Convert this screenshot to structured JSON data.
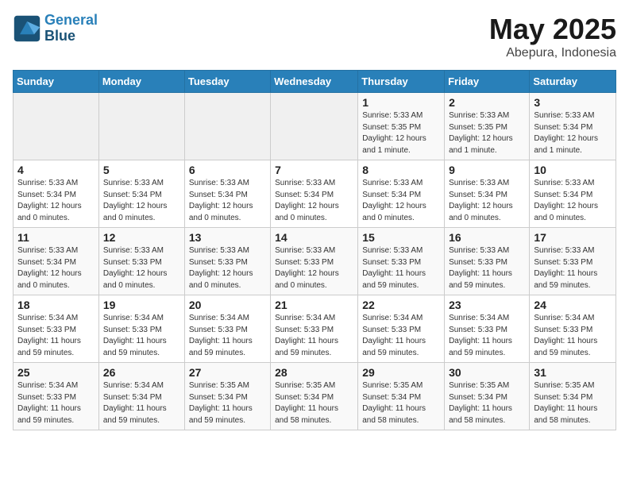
{
  "header": {
    "logo_line1": "General",
    "logo_line2": "Blue",
    "month": "May 2025",
    "location": "Abepura, Indonesia"
  },
  "weekdays": [
    "Sunday",
    "Monday",
    "Tuesday",
    "Wednesday",
    "Thursday",
    "Friday",
    "Saturday"
  ],
  "weeks": [
    [
      {
        "day": "",
        "info": ""
      },
      {
        "day": "",
        "info": ""
      },
      {
        "day": "",
        "info": ""
      },
      {
        "day": "",
        "info": ""
      },
      {
        "day": "1",
        "info": "Sunrise: 5:33 AM\nSunset: 5:35 PM\nDaylight: 12 hours\nand 1 minute."
      },
      {
        "day": "2",
        "info": "Sunrise: 5:33 AM\nSunset: 5:35 PM\nDaylight: 12 hours\nand 1 minute."
      },
      {
        "day": "3",
        "info": "Sunrise: 5:33 AM\nSunset: 5:34 PM\nDaylight: 12 hours\nand 1 minute."
      }
    ],
    [
      {
        "day": "4",
        "info": "Sunrise: 5:33 AM\nSunset: 5:34 PM\nDaylight: 12 hours\nand 0 minutes."
      },
      {
        "day": "5",
        "info": "Sunrise: 5:33 AM\nSunset: 5:34 PM\nDaylight: 12 hours\nand 0 minutes."
      },
      {
        "day": "6",
        "info": "Sunrise: 5:33 AM\nSunset: 5:34 PM\nDaylight: 12 hours\nand 0 minutes."
      },
      {
        "day": "7",
        "info": "Sunrise: 5:33 AM\nSunset: 5:34 PM\nDaylight: 12 hours\nand 0 minutes."
      },
      {
        "day": "8",
        "info": "Sunrise: 5:33 AM\nSunset: 5:34 PM\nDaylight: 12 hours\nand 0 minutes."
      },
      {
        "day": "9",
        "info": "Sunrise: 5:33 AM\nSunset: 5:34 PM\nDaylight: 12 hours\nand 0 minutes."
      },
      {
        "day": "10",
        "info": "Sunrise: 5:33 AM\nSunset: 5:34 PM\nDaylight: 12 hours\nand 0 minutes."
      }
    ],
    [
      {
        "day": "11",
        "info": "Sunrise: 5:33 AM\nSunset: 5:34 PM\nDaylight: 12 hours\nand 0 minutes."
      },
      {
        "day": "12",
        "info": "Sunrise: 5:33 AM\nSunset: 5:33 PM\nDaylight: 12 hours\nand 0 minutes."
      },
      {
        "day": "13",
        "info": "Sunrise: 5:33 AM\nSunset: 5:33 PM\nDaylight: 12 hours\nand 0 minutes."
      },
      {
        "day": "14",
        "info": "Sunrise: 5:33 AM\nSunset: 5:33 PM\nDaylight: 12 hours\nand 0 minutes."
      },
      {
        "day": "15",
        "info": "Sunrise: 5:33 AM\nSunset: 5:33 PM\nDaylight: 11 hours\nand 59 minutes."
      },
      {
        "day": "16",
        "info": "Sunrise: 5:33 AM\nSunset: 5:33 PM\nDaylight: 11 hours\nand 59 minutes."
      },
      {
        "day": "17",
        "info": "Sunrise: 5:33 AM\nSunset: 5:33 PM\nDaylight: 11 hours\nand 59 minutes."
      }
    ],
    [
      {
        "day": "18",
        "info": "Sunrise: 5:34 AM\nSunset: 5:33 PM\nDaylight: 11 hours\nand 59 minutes."
      },
      {
        "day": "19",
        "info": "Sunrise: 5:34 AM\nSunset: 5:33 PM\nDaylight: 11 hours\nand 59 minutes."
      },
      {
        "day": "20",
        "info": "Sunrise: 5:34 AM\nSunset: 5:33 PM\nDaylight: 11 hours\nand 59 minutes."
      },
      {
        "day": "21",
        "info": "Sunrise: 5:34 AM\nSunset: 5:33 PM\nDaylight: 11 hours\nand 59 minutes."
      },
      {
        "day": "22",
        "info": "Sunrise: 5:34 AM\nSunset: 5:33 PM\nDaylight: 11 hours\nand 59 minutes."
      },
      {
        "day": "23",
        "info": "Sunrise: 5:34 AM\nSunset: 5:33 PM\nDaylight: 11 hours\nand 59 minutes."
      },
      {
        "day": "24",
        "info": "Sunrise: 5:34 AM\nSunset: 5:33 PM\nDaylight: 11 hours\nand 59 minutes."
      }
    ],
    [
      {
        "day": "25",
        "info": "Sunrise: 5:34 AM\nSunset: 5:33 PM\nDaylight: 11 hours\nand 59 minutes."
      },
      {
        "day": "26",
        "info": "Sunrise: 5:34 AM\nSunset: 5:34 PM\nDaylight: 11 hours\nand 59 minutes."
      },
      {
        "day": "27",
        "info": "Sunrise: 5:35 AM\nSunset: 5:34 PM\nDaylight: 11 hours\nand 59 minutes."
      },
      {
        "day": "28",
        "info": "Sunrise: 5:35 AM\nSunset: 5:34 PM\nDaylight: 11 hours\nand 58 minutes."
      },
      {
        "day": "29",
        "info": "Sunrise: 5:35 AM\nSunset: 5:34 PM\nDaylight: 11 hours\nand 58 minutes."
      },
      {
        "day": "30",
        "info": "Sunrise: 5:35 AM\nSunset: 5:34 PM\nDaylight: 11 hours\nand 58 minutes."
      },
      {
        "day": "31",
        "info": "Sunrise: 5:35 AM\nSunset: 5:34 PM\nDaylight: 11 hours\nand 58 minutes."
      }
    ]
  ]
}
